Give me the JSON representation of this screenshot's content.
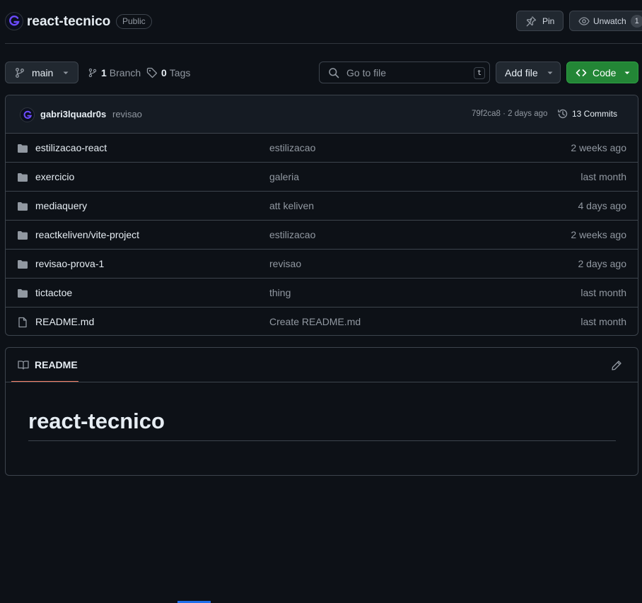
{
  "repo": {
    "name": "react-tecnico",
    "visibility": "Public"
  },
  "header_actions": {
    "pin_label": "Pin",
    "watch_label": "Unwatch",
    "watch_count": "1"
  },
  "toolbar": {
    "branch": "main",
    "branch_count": "1",
    "branch_label": "Branch",
    "tag_count": "0",
    "tag_label": "Tags",
    "search_placeholder": "Go to file",
    "search_shortcut": "t",
    "add_file_label": "Add file",
    "code_label": "Code"
  },
  "latest_commit": {
    "author": "gabri3lquadr0s",
    "message": "revisao",
    "meta": "79f2ca8 · 2 days ago",
    "commits_label": "13 Commits"
  },
  "files": [
    {
      "name": "estilizacao-react",
      "message": "estilizacao",
      "date": "2 weeks ago",
      "type": "folder"
    },
    {
      "name": "exercicio",
      "message": "galeria",
      "date": "last month",
      "type": "folder"
    },
    {
      "name": "mediaquery",
      "message": "att keliven",
      "date": "4 days ago",
      "type": "folder"
    },
    {
      "name": "reactkeliven/vite-project",
      "message": "estilizacao",
      "date": "2 weeks ago",
      "type": "folder"
    },
    {
      "name": "revisao-prova-1",
      "message": "revisao",
      "date": "2 days ago",
      "type": "folder"
    },
    {
      "name": "tictactoe",
      "message": "thing",
      "date": "last month",
      "type": "folder"
    },
    {
      "name": "README.md",
      "message": "Create README.md",
      "date": "last month",
      "type": "file"
    }
  ],
  "readme": {
    "tab_label": "README",
    "heading": "react-tecnico"
  },
  "colors": {
    "background": "#0d1117",
    "border": "#3d444d",
    "muted_text": "#9198a1",
    "code_button": "#238636",
    "readme_tab_accent": "#f78166",
    "folder_icon": "#9198a1"
  },
  "icons": {
    "avatar": "avatar-logo-icon",
    "pin": "pin-icon",
    "watch": "eye-icon",
    "branch": "git-branch-icon",
    "tag": "tag-icon",
    "search": "search-icon",
    "code": "code-icon",
    "history": "history-icon",
    "folder": "folder-icon",
    "file": "file-icon",
    "book": "book-icon",
    "edit": "pencil-icon"
  }
}
